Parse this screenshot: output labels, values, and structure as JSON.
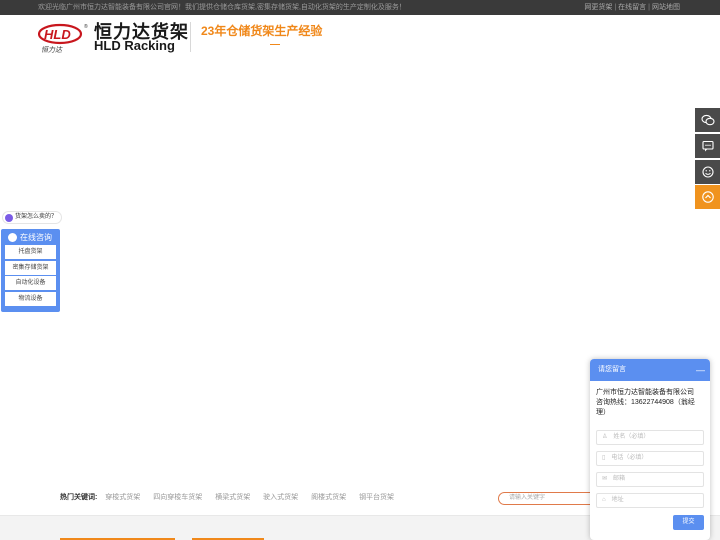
{
  "topbar": {
    "welcome": "欢迎光临广州市恒力达智能装备有限公司官网！我们提供仓储仓库货架,密集存储货架,自动化货架的生产定制化及服务！",
    "links": [
      "网更货架",
      "在线留言",
      "网站地图"
    ]
  },
  "header": {
    "brand_cn": "恒力达货架",
    "brand_en": "HLD Racking",
    "logo_text": "恒力达",
    "slogan": "23年仓储货架生产经验"
  },
  "right_bar": {
    "icons": [
      "wechat-icon",
      "message-icon",
      "smile-icon",
      "back-to-top-icon"
    ],
    "top_color": "#f0931e"
  },
  "consult": {
    "faq": "货架怎么卖的？",
    "title": "在线咨询",
    "items": [
      "托盘货架",
      "密集存储货架",
      "自动化设备",
      "物流设备"
    ]
  },
  "hot": {
    "label": "热门关键词:",
    "keywords": [
      "穿梭式货架",
      "四向穿梭车货架",
      "横梁式货架",
      "驶入式货架",
      "阁楼式货架",
      "钢平台货架"
    ],
    "search_placeholder": "请输入关键字"
  },
  "dialog": {
    "title": "请您留言",
    "minimize": "—",
    "company": "广州市恒力达智能装备有限公司",
    "hotline": "咨询热线：13622744908（翁经理）",
    "fields": {
      "name": "姓名（必填）",
      "phone": "电话（必填）",
      "email": "邮箱",
      "address": "地址"
    },
    "submit": "提交"
  },
  "colors": {
    "accent_orange": "#f0881a",
    "accent_blue": "#5b8ff0",
    "topbar": "#3a3a3a"
  }
}
